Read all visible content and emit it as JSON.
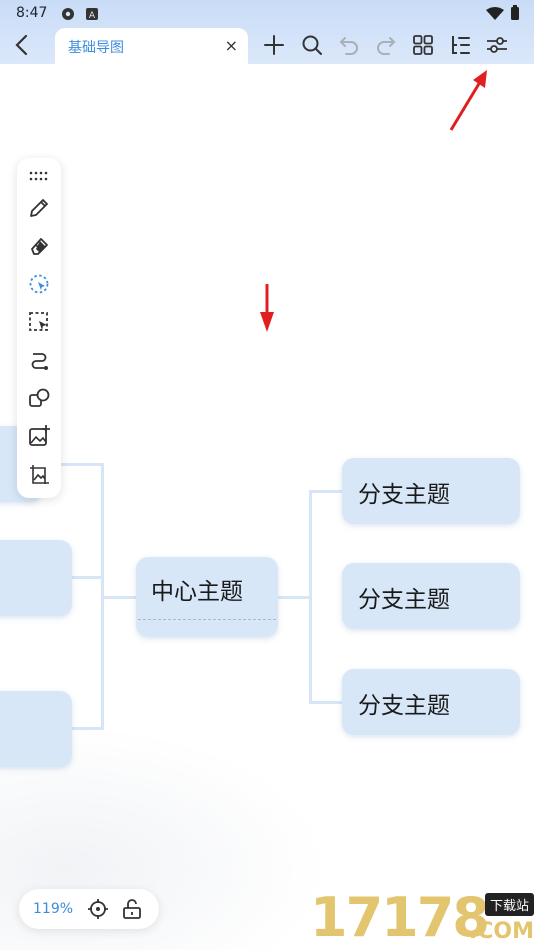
{
  "status_bar": {
    "time": "8:47",
    "icons": [
      "settings-gear-icon",
      "a-badge-icon",
      "wifi-icon",
      "battery-icon"
    ]
  },
  "header": {
    "tab_title": "基础导图",
    "tab_close": "×",
    "toolbar_icons": [
      "add-icon",
      "search-icon",
      "undo-icon",
      "redo-icon",
      "grid-icon",
      "outline-icon",
      "settings-sliders-icon"
    ]
  },
  "side_toolbar": {
    "items": [
      "drag-handle-icon",
      "pen-icon",
      "eraser-icon",
      "lasso-select-icon",
      "box-select-icon",
      "connector-icon",
      "shape-icon",
      "insert-image-icon",
      "image-icon"
    ]
  },
  "mindmap": {
    "center_topic": "中心主题",
    "branches": [
      "分支主题",
      "分支主题",
      "分支主题"
    ]
  },
  "zoom_panel": {
    "zoom": "119%",
    "icons": [
      "locate-icon",
      "unlock-icon"
    ]
  },
  "watermark": {
    "number": "17178",
    "badge": "下载站",
    "com": ".COM"
  },
  "colors": {
    "accent": "#3c8cdf",
    "node_fill": "#d7e7f8",
    "connector": "#d6e6f6",
    "annotation_red": "#e02020"
  }
}
